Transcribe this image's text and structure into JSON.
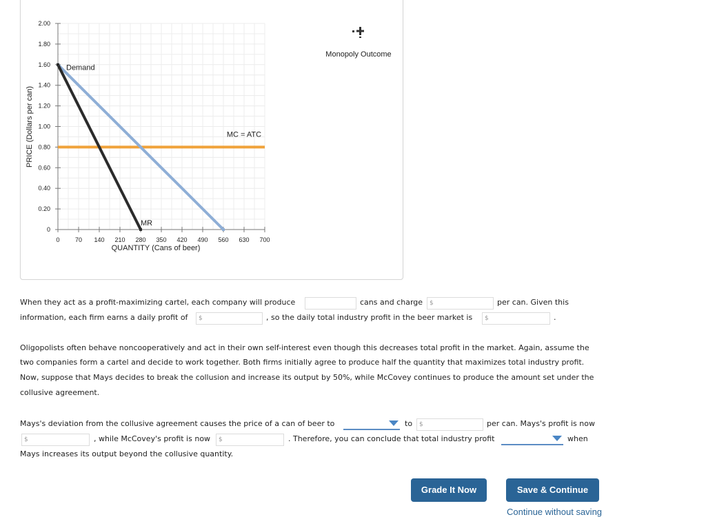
{
  "chart_data": {
    "type": "line",
    "title": "",
    "xlabel": "QUANTITY (Cans of beer)",
    "ylabel": "PRICE (Dollars per can)",
    "xlim": [
      0,
      700
    ],
    "ylim": [
      0,
      2.0
    ],
    "grid": true,
    "x_ticks": [
      "0",
      "70",
      "140",
      "210",
      "280",
      "350",
      "420",
      "490",
      "560",
      "630",
      "700"
    ],
    "y_ticks": [
      "0",
      "0.20",
      "0.40",
      "0.60",
      "0.80",
      "1.00",
      "1.20",
      "1.40",
      "1.60",
      "1.80",
      "2.00"
    ],
    "series": [
      {
        "name": "Demand",
        "color": "#8eaed6",
        "points": [
          [
            0,
            1.6
          ],
          [
            560,
            0
          ]
        ]
      },
      {
        "name": "MR",
        "color": "#2b2b2b",
        "points": [
          [
            0,
            1.6
          ],
          [
            280,
            0
          ]
        ]
      },
      {
        "name": "MC = ATC",
        "color": "#f0a23a",
        "points": [
          [
            0,
            0.8
          ],
          [
            700,
            0.8
          ]
        ]
      }
    ],
    "labels": [
      {
        "text": "Demand",
        "x": 28,
        "y": 1.55
      },
      {
        "text": "MR",
        "x": 300,
        "y": 0.04
      },
      {
        "text": "MC = ATC",
        "x": 630,
        "y": 0.9
      }
    ]
  },
  "tool": {
    "icon": "monopoly-outcome-plus-icon",
    "label": "Monopoly Outcome"
  },
  "question1": {
    "line1_a": "When they act as a profit-maximizing cartel, each company will produce",
    "line1_b": "cans and charge",
    "line1_c": "per can. Given this",
    "line2_a": "information, each firm earns a daily profit of",
    "line2_b": ", so the daily total industry profit in the beer market is",
    "line2_c": ".",
    "quantity_value": "",
    "price_placeholder": "$",
    "firm_profit_placeholder": "$",
    "industry_profit_placeholder": "$"
  },
  "paragraph": [
    "Oligopolists often behave noncooperatively and act in their own self-interest even though this decreases total profit in the market. Again, assume the",
    "two companies form a cartel and decide to work together. Both firms initially agree to produce half the quantity that maximizes total industry profit.",
    "Now, suppose that Mays decides to break the collusion and increase its output by 50%, while McCovey continues to produce the amount set under the",
    "collusive agreement."
  ],
  "question2": {
    "line1_a": "Mays's deviation from the collusive agreement causes the price of a can of beer to",
    "line1_b": "to",
    "line1_c": "per can. Mays's profit is now",
    "line2_a": ", while McCovey's profit is now",
    "line2_b": ". Therefore, you can conclude that total industry profit",
    "line2_c": "when",
    "line3": "Mays increases its output beyond the collusive quantity.",
    "price_direction_selected": "",
    "new_price_placeholder": "$",
    "mays_profit_placeholder": "$",
    "mccovey_profit_placeholder": "$",
    "profit_change_selected": ""
  },
  "buttons": {
    "grade": "Grade It Now",
    "save": "Save & Continue",
    "continue": "Continue without saving"
  },
  "colors": {
    "button": "#2a6496",
    "demand": "#8eaed6",
    "mr": "#2b2b2b",
    "mc": "#f0a23a",
    "dropdown": "#4a86c5"
  }
}
